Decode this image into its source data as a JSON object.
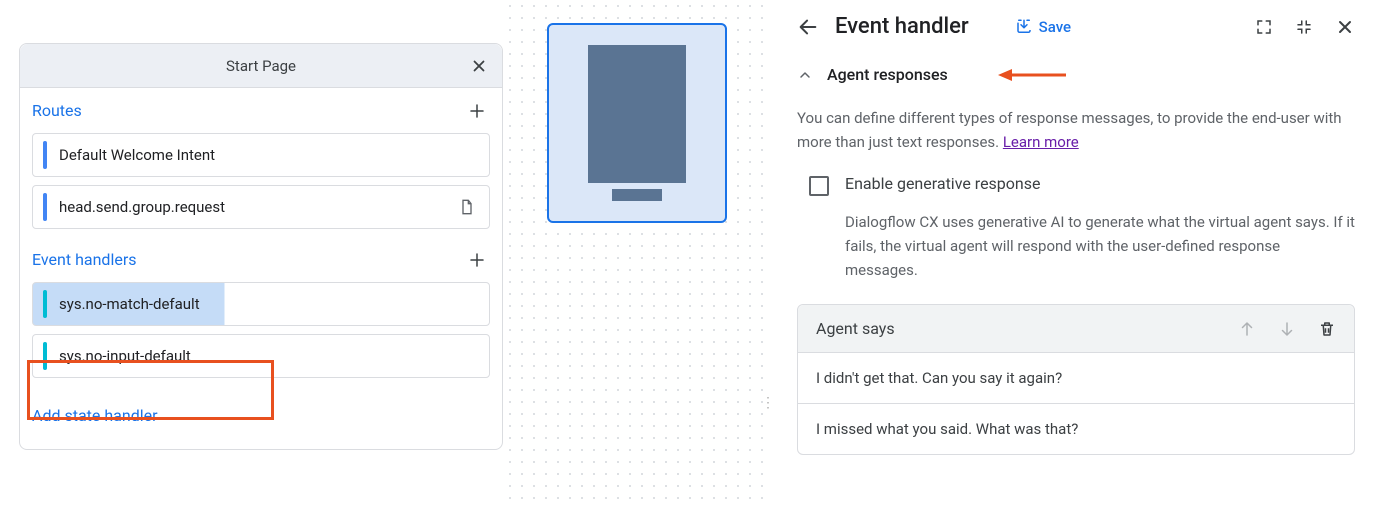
{
  "start_page": {
    "title": "Start Page",
    "routes_label": "Routes",
    "routes": [
      {
        "label": "Default Welcome Intent"
      },
      {
        "label": "head.send.group.request",
        "has_doc": true
      }
    ],
    "event_handlers_label": "Event handlers",
    "event_handlers": [
      {
        "label": "sys.no-match-default",
        "selected": true
      },
      {
        "label": "sys.no-input-default"
      }
    ],
    "add_state_label": "Add state handler"
  },
  "panel": {
    "title": "Event handler",
    "save_label": "Save",
    "section_title": "Agent responses",
    "description": "You can define different types of response messages, to provide the end-user with more than just text responses. ",
    "learn_more": "Learn more",
    "checkbox_label": "Enable generative response",
    "checkbox_desc": "Dialogflow CX uses generative AI to generate what the virtual agent says. If it fails, the virtual agent will respond with the user-defined response messages.",
    "agent_says_label": "Agent says",
    "responses": [
      "I didn't get that. Can you say it again?",
      "I missed what you said. What was that?"
    ]
  }
}
